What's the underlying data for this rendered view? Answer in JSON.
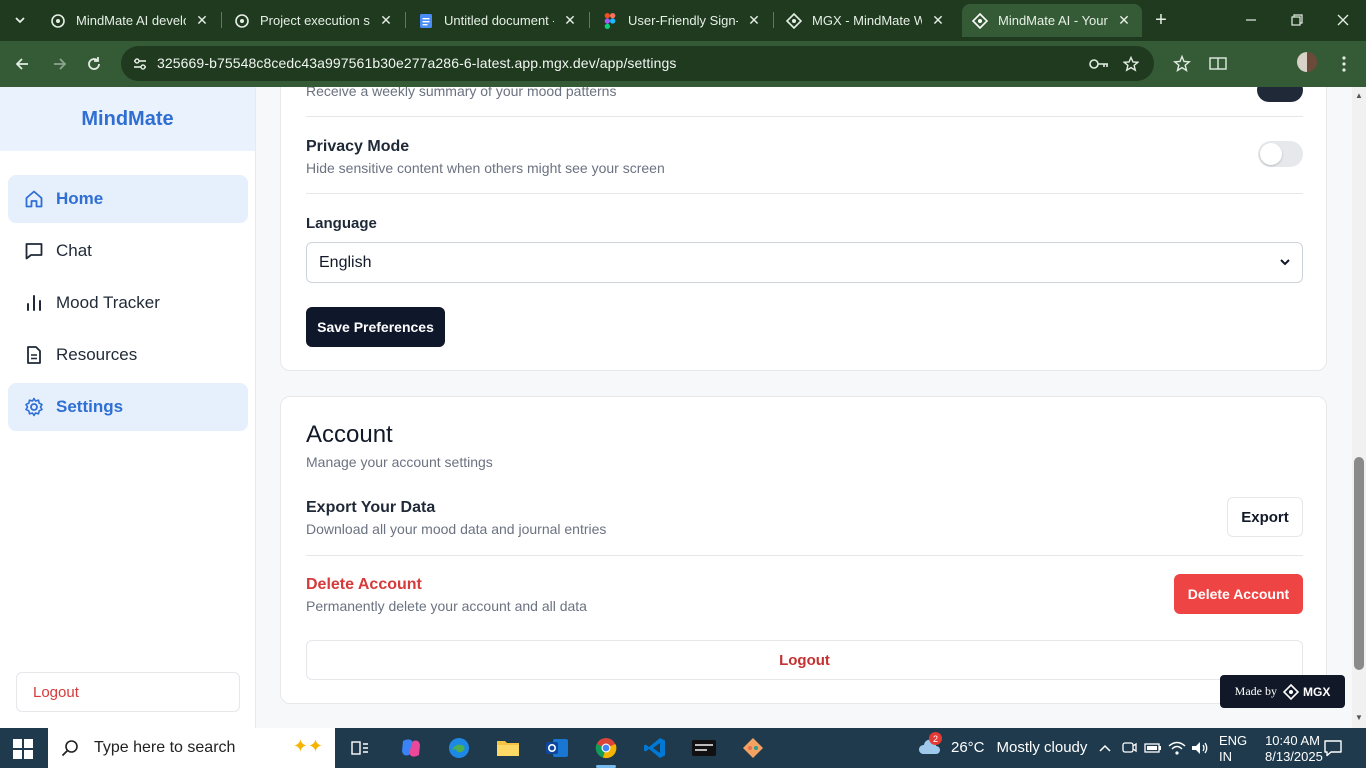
{
  "browser": {
    "tabs": [
      {
        "title": "MindMate AI develop",
        "icon": "openai-icon",
        "active": false
      },
      {
        "title": "Project execution sup",
        "icon": "openai-icon",
        "active": false
      },
      {
        "title": "Untitled document - (",
        "icon": "google-docs-icon",
        "active": false
      },
      {
        "title": "User-Friendly Sign-Up",
        "icon": "figma-icon",
        "active": false
      },
      {
        "title": "MGX - MindMate Wi",
        "icon": "mgx-icon",
        "active": false
      },
      {
        "title": "MindMate AI - Your M",
        "icon": "mgx-icon",
        "active": true
      }
    ],
    "url": "325669-b75548c8cedc43a997561b30e277a286-6-latest.app.mgx.dev/app/settings"
  },
  "sidebar": {
    "brand": "MindMate",
    "items": [
      {
        "label": "Home",
        "icon": "home-icon"
      },
      {
        "label": "Chat",
        "icon": "chat-icon"
      },
      {
        "label": "Mood Tracker",
        "icon": "bar-chart-icon"
      },
      {
        "label": "Resources",
        "icon": "document-icon"
      },
      {
        "label": "Settings",
        "icon": "gear-icon"
      }
    ],
    "logout": "Logout"
  },
  "preferences": {
    "weekly_desc": "Receive a weekly summary of your mood patterns",
    "privacy_title": "Privacy Mode",
    "privacy_desc": "Hide sensitive content when others might see your screen",
    "privacy_enabled": false,
    "language_label": "Language",
    "language_value": "English",
    "save_label": "Save Preferences"
  },
  "account": {
    "title": "Account",
    "subtitle": "Manage your account settings",
    "export_title": "Export Your Data",
    "export_desc": "Download all your mood data and journal entries",
    "export_button": "Export",
    "delete_title": "Delete Account",
    "delete_desc": "Permanently delete your account and all data",
    "delete_button": "Delete Account",
    "logout_button": "Logout"
  },
  "badge": {
    "prefix": "Made by",
    "brand": "MGX"
  },
  "taskbar": {
    "search_placeholder": "Type here to search",
    "weather_temp": "26°C",
    "weather_desc": "Mostly cloudy",
    "weather_badge": "2",
    "lang_top": "ENG",
    "lang_bottom": "IN",
    "time": "10:40 AM",
    "date": "8/13/2025"
  },
  "colors": {
    "accent": "#2f6fd4",
    "danger": "#ef4444",
    "dark_button": "#0f172a"
  }
}
